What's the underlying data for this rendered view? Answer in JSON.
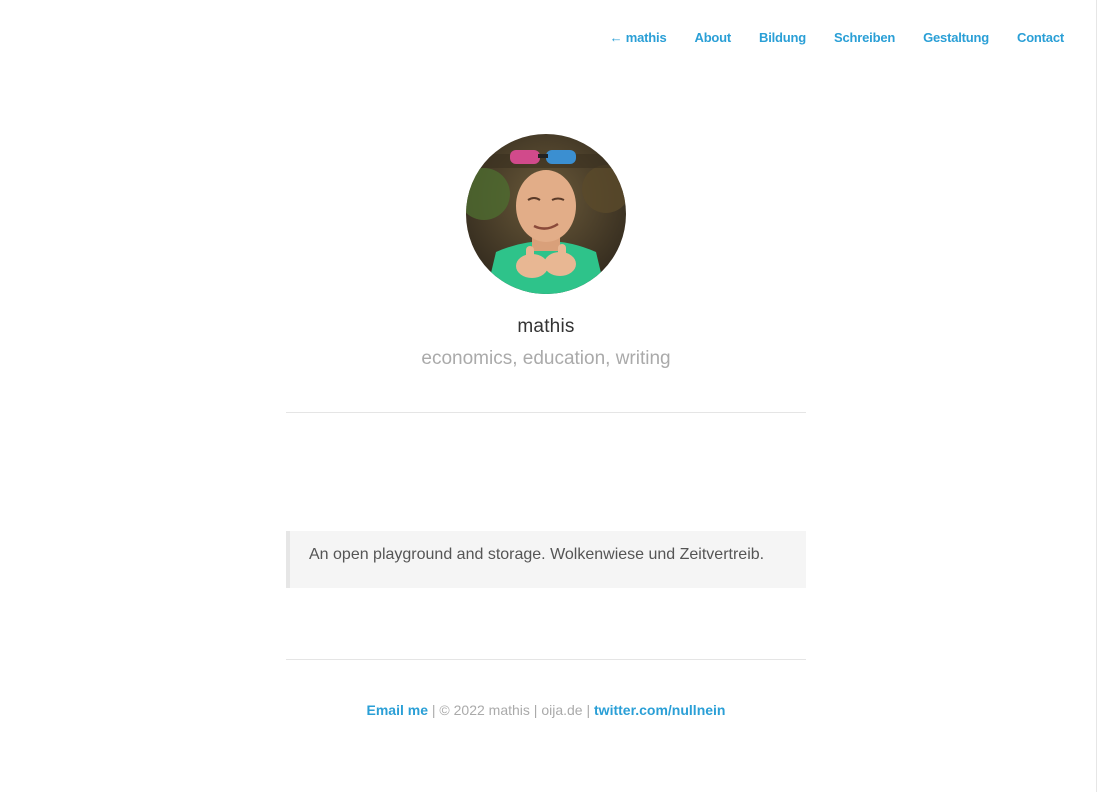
{
  "nav": {
    "items": [
      {
        "label": "← mathis"
      },
      {
        "label": "About"
      },
      {
        "label": "Bildung"
      },
      {
        "label": "Schreiben"
      },
      {
        "label": "Gestaltung"
      },
      {
        "label": "Contact"
      }
    ]
  },
  "profile": {
    "name": "mathis",
    "tagline": "economics, education, writing"
  },
  "intro": {
    "text": "An open playground and storage. Wolkenwiese und Zeitvertreib."
  },
  "footer": {
    "email_label": "Email me",
    "sep1": " | ",
    "copyright": "© 2022 mathis",
    "sep2": " | ",
    "domain": "oija.de",
    "sep3": " | ",
    "twitter_label": "twitter.com/nullnein"
  },
  "colors": {
    "link": "#2a9fd6",
    "muted": "#aaaaaa",
    "text": "#333333"
  }
}
